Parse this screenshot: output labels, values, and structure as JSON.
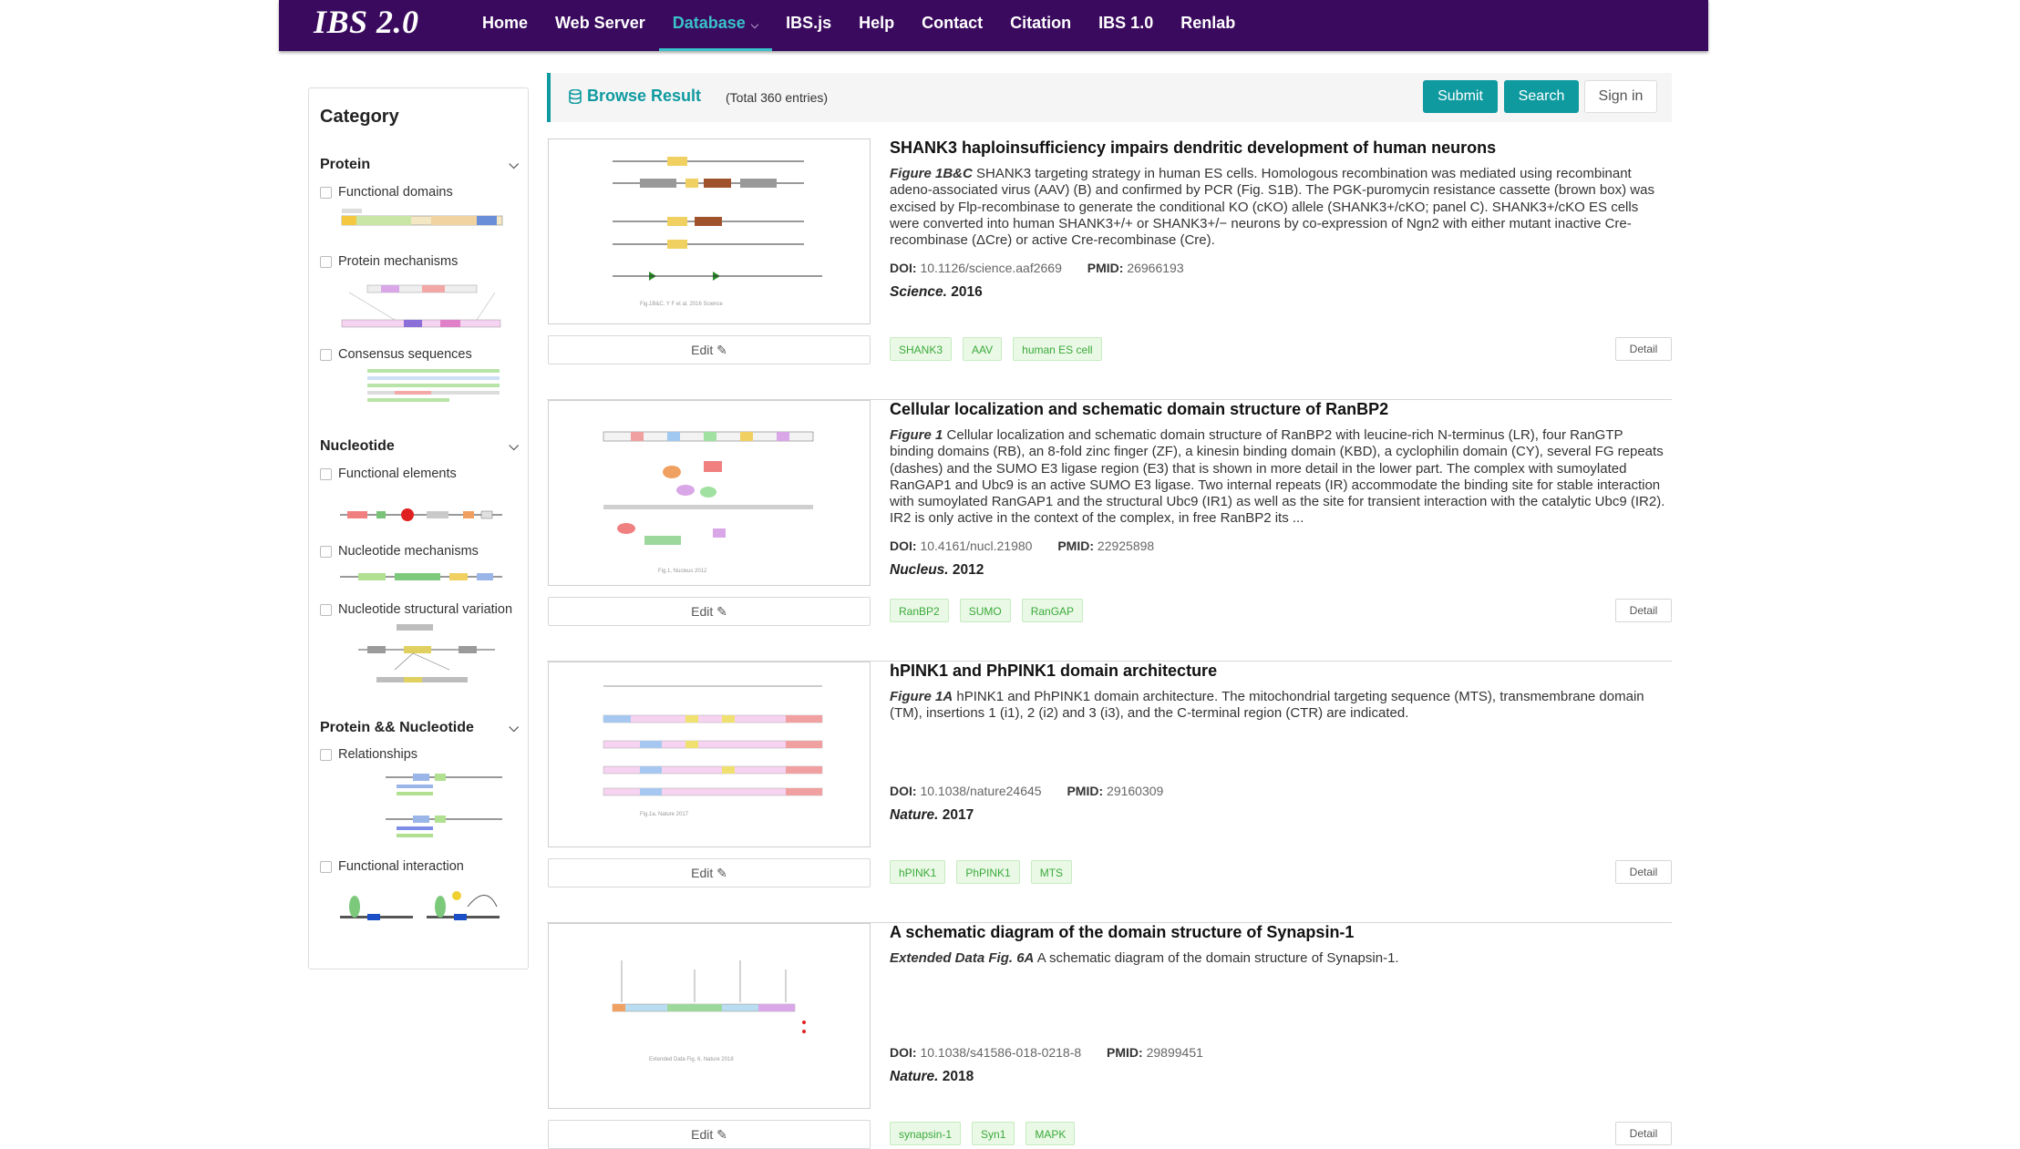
{
  "nav": {
    "brand": "IBS 2.0",
    "items": [
      "Home",
      "Web Server",
      "Database",
      "IBS.js",
      "Help",
      "Contact",
      "Citation",
      "IBS 1.0",
      "Renlab"
    ],
    "active_index": 2
  },
  "sidebar": {
    "title": "Category",
    "sections": [
      {
        "label": "Protein",
        "items": [
          "Functional domains",
          "Protein mechanisms",
          "Consensus sequences"
        ]
      },
      {
        "label": "Nucleotide",
        "items": [
          "Functional elements",
          "Nucleotide mechanisms",
          "Nucleotide structural variation"
        ]
      },
      {
        "label": "Protein && Nucleotide",
        "items": [
          "Relationships",
          "Functional interaction"
        ]
      }
    ]
  },
  "result_header": {
    "title": "Browse Result",
    "count": "(Total 360 entries)",
    "submit_label": "Submit",
    "search_label": "Search",
    "signin_label": "Sign in"
  },
  "labels": {
    "edit": "Edit ✎",
    "detail": "Detail",
    "doi": "DOI:",
    "pmid": "PMID:"
  },
  "entries": [
    {
      "title": "SHANK3 haploinsufficiency impairs dendritic development of human neurons",
      "fig_label": "Figure 1B&C",
      "description": " SHANK3 targeting strategy in human ES cells. Homologous recombination was mediated using recombinant adeno-associated virus (AAV) (B) and confirmed by PCR (Fig. S1B). The PGK-puromycin resistance cassette (brown box) was excised by Flp-recombinase to generate the conditional KO (cKO) allele (SHANK3+/cKO; panel C). SHANK3+/cKO ES cells were converted into human SHANK3+/+ or SHANK3+/− neurons by co-expression of Ngn2 with either mutant inactive Cre-recombinase (ΔCre) or active Cre-recombinase (Cre).",
      "doi": "10.1126/science.aaf2669",
      "pmid": "26966193",
      "journal": "Science.",
      "year": "2016",
      "tags": [
        "SHANK3",
        "AAV",
        "human ES cell"
      ]
    },
    {
      "title": "Cellular localization and schematic domain structure of RanBP2",
      "fig_label": "Figure 1",
      "description": " Cellular localization and schematic domain structure of RanBP2 with leucine-rich N-terminus (LR), four RanGTP binding domains (RB), an 8-fold zinc finger (ZF), a kinesin binding domain (KBD), a cyclophilin domain (CY), several FG repeats (dashes) and the SUMO E3 ligase region (E3) that is shown in more detail in the lower part. The complex with sumoylated RanGAP1 and Ubc9 is an active SUMO E3 ligase. Two internal repeats (IR) accommodate the binding site for stable interaction with sumoylated RanGAP1 and the structural Ubc9 (IR1) as well as the site for transient interaction with the catalytic Ubc9 (IR2). IR2 is only active in the context of the complex, in free RanBP2 its ...",
      "doi": "10.4161/nucl.21980",
      "pmid": "22925898",
      "journal": "Nucleus.",
      "year": "2012",
      "tags": [
        "RanBP2",
        "SUMO",
        "RanGAP"
      ]
    },
    {
      "title": "hPINK1 and PhPINK1 domain architecture",
      "fig_label": "Figure 1A",
      "description": " hPINK1 and PhPINK1 domain architecture. The mitochondrial targeting sequence (MTS), transmembrane domain (TM), insertions 1 (i1), 2 (i2) and 3 (i3), and the C-terminal region (CTR) are indicated.",
      "doi": "10.1038/nature24645",
      "pmid": "29160309",
      "journal": "Nature.",
      "year": "2017",
      "tags": [
        "hPINK1",
        "PhPINK1",
        "MTS"
      ]
    },
    {
      "title": "A schematic diagram of the domain structure of Synapsin-1",
      "fig_label": "Extended Data Fig. 6A",
      "description": " A schematic diagram of the domain structure of Synapsin-1.",
      "doi": "10.1038/s41586-018-0218-8",
      "pmid": "29899451",
      "journal": "Nature.",
      "year": "2018",
      "tags": [
        "synapsin-1",
        "Syn1",
        "MAPK"
      ]
    }
  ],
  "colors": {
    "nav_bg": "#3a0a5e",
    "accent": "#0f9aa0",
    "tag_text": "#3bab3b"
  }
}
